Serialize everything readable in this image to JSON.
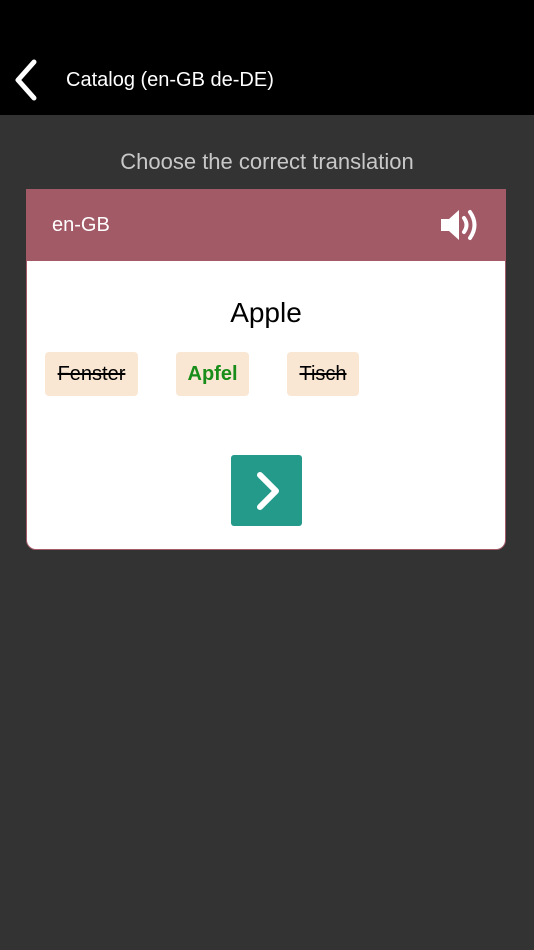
{
  "navbar": {
    "title": "Catalog (en-GB de-DE)",
    "back_icon": "chevron-left-icon"
  },
  "prompt": "Choose the correct translation",
  "card": {
    "source_language": "en-GB",
    "speaker_icon": "speaker-icon",
    "word": "Apple",
    "options": [
      {
        "label": "Fenster",
        "state": "wrong"
      },
      {
        "label": "Apfel",
        "state": "correct"
      },
      {
        "label": "Tisch",
        "state": "wrong"
      }
    ],
    "next_icon": "chevron-right-icon"
  },
  "colors": {
    "header": "#a35a67",
    "option_bg": "#f9e6d3",
    "correct": "#198d19",
    "next_button": "#249a8a",
    "background": "#333333"
  }
}
